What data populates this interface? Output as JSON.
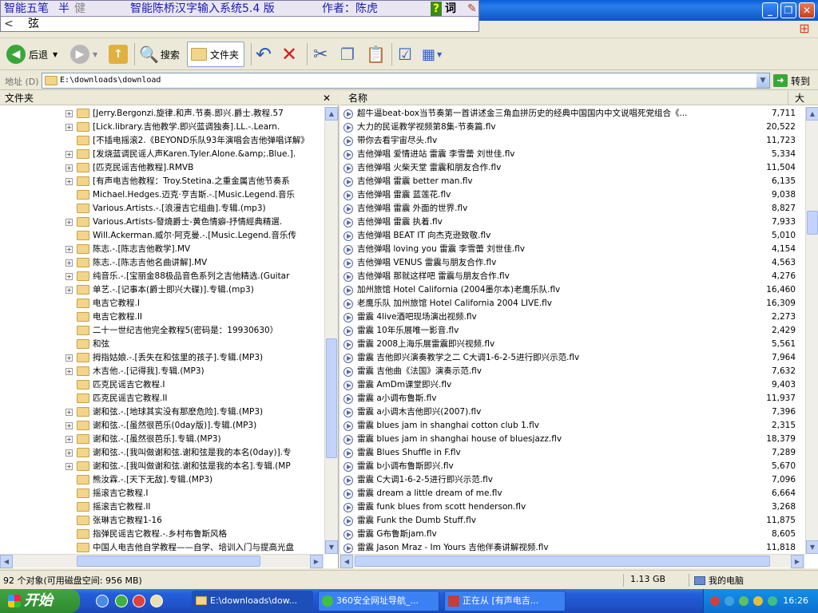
{
  "ime": {
    "mode_wubi": "智能五笔",
    "half": "半",
    "full": "健",
    "title": "智能陈桥汉字输入系统5.4 版",
    "author": "作者：陈虎",
    "help": "?",
    "ci": "词",
    "input_prefix": "<",
    "input_text": "弦"
  },
  "titlebar": {
    "minimize": "_",
    "restore": "❐",
    "close": "✕"
  },
  "toolbar": {
    "back": "后退",
    "search": "搜索",
    "folders": "文件夹"
  },
  "address": {
    "label": "地址 (D)",
    "path": "E:\\downloads\\download",
    "go": "转到"
  },
  "folder_pane": {
    "title": "文件夹",
    "close": "✕",
    "items": [
      {
        "text": "[Jerry.Bergonzi.旋律.和声.节奏.即兴.爵士.教程.57",
        "exp": true
      },
      {
        "text": "[Lick.library.吉他教学.即兴蓝调独奏].LL.-.Learn.",
        "exp": true
      },
      {
        "text": "[不插电摇滚2.《BEYOND乐队93年演唱会吉他弹唱详解》",
        "exp": false
      },
      {
        "text": "[发烧蓝调民谣人声Karen.Tyler.Alone.&amp;.Blue.].",
        "exp": true
      },
      {
        "text": "[匹克民谣吉他教程].RMVB",
        "exp": true
      },
      {
        "text": "[有声电吉他教程：Troy.Stetina.之重金属吉他节奏系",
        "exp": true
      },
      {
        "text": "Michael.Hedges.迈克·亨吉斯.-.[Music.Legend.音乐",
        "exp": false
      },
      {
        "text": "Various.Artists.-.[浪漫吉它组曲].专辑.(mp3)",
        "exp": false
      },
      {
        "text": "Various.Artists-發燒爵士-黄色情癖-抒情經典精選.",
        "exp": true
      },
      {
        "text": "Will.Ackerman.威尔·阿克曼.-.[Music.Legend.音乐传",
        "exp": false
      },
      {
        "text": "陈志.-.[陈志吉他教学].MV",
        "exp": true
      },
      {
        "text": "陈志.-.[陈志吉他名曲讲解].MV",
        "exp": true
      },
      {
        "text": "纯音乐.-.[宝丽金88极品音色系列之吉他精选.(Guitar",
        "exp": true
      },
      {
        "text": "单艺.-.[记事本(爵士即兴大碟)].专辑.(mp3)",
        "exp": true
      },
      {
        "text": "电吉它教程.I",
        "exp": false
      },
      {
        "text": "电吉它教程.II",
        "exp": false
      },
      {
        "text": "二十一世纪吉他完全教程5(密码是：19930630）",
        "exp": false
      },
      {
        "text": "和弦",
        "exp": false
      },
      {
        "text": "拇指姑娘.-.[丢失在和弦里的孩子].专辑.(MP3)",
        "exp": true
      },
      {
        "text": "木吉他.-.[记得我].专辑.(MP3)",
        "exp": true
      },
      {
        "text": "匹克民谣吉它教程.I",
        "exp": false
      },
      {
        "text": "匹克民谣吉它教程.II",
        "exp": false
      },
      {
        "text": "谢和弦.-.[地球其实没有那麽危险].专辑.(MP3)",
        "exp": true
      },
      {
        "text": "谢和弦.-.[虽然很芭乐(0day版)].专辑.(MP3)",
        "exp": true
      },
      {
        "text": "谢和弦.-.[虽然很芭乐].专辑.(MP3)",
        "exp": true
      },
      {
        "text": "谢和弦.-.[我叫做谢和弦.谢和弦是我的本名(0day)].专",
        "exp": true
      },
      {
        "text": "谢和弦.-.[我叫做谢和弦.谢和弦是我的本名].专辑.(MP",
        "exp": true
      },
      {
        "text": "熊汝霖.-.[天下无敌].专辑.(MP3)",
        "exp": false
      },
      {
        "text": "摇滚吉它教程.I",
        "exp": false
      },
      {
        "text": "摇滚吉它教程.II",
        "exp": false
      },
      {
        "text": "张琳吉它教程1-16",
        "exp": false
      },
      {
        "text": "指弹民谣吉它教程.-.乡村布鲁斯风格",
        "exp": false
      },
      {
        "text": "中国人电吉他自学教程——自学、培训入门与提高光盘",
        "exp": false
      }
    ]
  },
  "list_pane": {
    "col_name": "名称",
    "col_size": "大",
    "files": [
      {
        "name": "超牛逼beat-box当节奏第一首讲述金三角血拼历史的经典中国国内中文说唱死党组合《...",
        "size": "7,711"
      },
      {
        "name": "大力的民谣教学视频第8集-节奏篇.flv",
        "size": "20,522"
      },
      {
        "name": "带你去看宇宙尽头.flv",
        "size": "11,723"
      },
      {
        "name": "吉他弹唱  爱情进站  雷震 李雪蕾 刘世佳.flv",
        "size": "5,334"
      },
      {
        "name": "吉他弹唱  火柴天堂  雷震和朋友合作.flv",
        "size": "11,504"
      },
      {
        "name": "吉他弹唱  雷震  better man.flv",
        "size": "6,135"
      },
      {
        "name": "吉他弹唱  雷震  蓝莲花.flv",
        "size": "9,038"
      },
      {
        "name": "吉他弹唱  雷震  外面的世界.flv",
        "size": "8,827"
      },
      {
        "name": "吉他弹唱  雷震  执着.flv",
        "size": "7,933"
      },
      {
        "name": "吉他弹唱 BEAT IT 向杰克逊致敬.flv",
        "size": "5,010"
      },
      {
        "name": "吉他弹唱 loving you  雷震 李雪蕾 刘世佳.flv",
        "size": "4,154"
      },
      {
        "name": "吉他弹唱 VENUS   雷震与朋友合作.flv",
        "size": "4,563"
      },
      {
        "name": "吉他弹唱 那就这样吧  雷震与朋友合作.flv",
        "size": "4,276"
      },
      {
        "name": "加州旅馆 Hotel California (2004墨尔本)老鹰乐队.flv",
        "size": "16,460"
      },
      {
        "name": "老鹰乐队 加州旅馆 Hotel California 2004 LIVE.flv",
        "size": "16,309"
      },
      {
        "name": "雷震  4live酒吧现场演出视频.flv",
        "size": "2,273"
      },
      {
        "name": "雷震  10年乐展唯一影音.flv",
        "size": "2,429"
      },
      {
        "name": "雷震  2008上海乐展雷震即兴视频.flv",
        "size": "5,561"
      },
      {
        "name": "雷震   吉他即兴演奏教学之二   C大调1-6-2-5进行即兴示范.flv",
        "size": "7,964"
      },
      {
        "name": "雷震   吉他曲《法国》演奏示范.flv",
        "size": "7,632"
      },
      {
        "name": "雷震  AmDm课堂即兴.flv",
        "size": "9,403"
      },
      {
        "name": "雷震  a小调布鲁斯.flv",
        "size": "11,937"
      },
      {
        "name": "雷震  a小调木吉他即兴(2007).flv",
        "size": "7,396"
      },
      {
        "name": "雷震  blues jam in shanghai cotton club 1.flv",
        "size": "2,315"
      },
      {
        "name": "雷震  blues jam in shanghai house of bluesjazz.flv",
        "size": "18,379"
      },
      {
        "name": "雷震  Blues Shuffle in F.flv",
        "size": "7,289"
      },
      {
        "name": "雷震  b小调布鲁斯即兴.flv",
        "size": "5,670"
      },
      {
        "name": "雷震  C大调1-6-2-5进行即兴示范.flv",
        "size": "7,096"
      },
      {
        "name": "雷震  dream a little dream of me.flv",
        "size": "6,664"
      },
      {
        "name": "雷震  funk blues from scott henderson.flv",
        "size": "3,268"
      },
      {
        "name": "雷震  Funk the Dumb Stuff.flv",
        "size": "11,875"
      },
      {
        "name": "雷震  G布鲁斯jam.flv",
        "size": "8,605"
      },
      {
        "name": "雷震  Jason Mraz -  Im Yours 吉他伴奏讲解视频.flv",
        "size": "11,818"
      }
    ]
  },
  "status": {
    "objects": "92 个对象(可用磁盘空间: 956 MB)",
    "size": "1.13 GB",
    "location": "我的电脑"
  },
  "taskbar": {
    "start": "开始",
    "tasks": [
      "E:\\downloads\\dow...",
      "360安全网址导航_...",
      "正在从 [有声电吉..."
    ],
    "clock": "16:26"
  }
}
